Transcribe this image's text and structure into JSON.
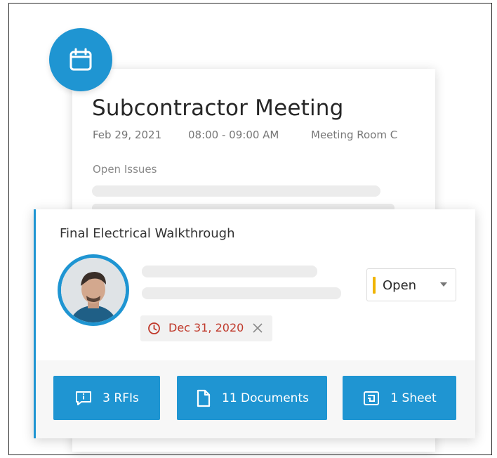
{
  "meeting": {
    "title": "Subcontractor Meeting",
    "date": "Feb 29, 2021",
    "time": "08:00 - 09:00 AM",
    "location": "Meeting Room C",
    "section_label": "Open Issues",
    "icon": "calendar-icon"
  },
  "issue": {
    "title": "Final Electrical Walkthrough",
    "status": "Open",
    "status_color": "#f0b400",
    "due_date": "Dec 31, 2020",
    "due_color": "#c0392b"
  },
  "actions": [
    {
      "label": "3 RFIs",
      "icon": "rfi-icon"
    },
    {
      "label": "11 Documents",
      "icon": "document-icon"
    },
    {
      "label": "1 Sheet",
      "icon": "sheet-icon"
    }
  ],
  "colors": {
    "accent": "#1f95d2",
    "skeleton": "#ececec"
  }
}
